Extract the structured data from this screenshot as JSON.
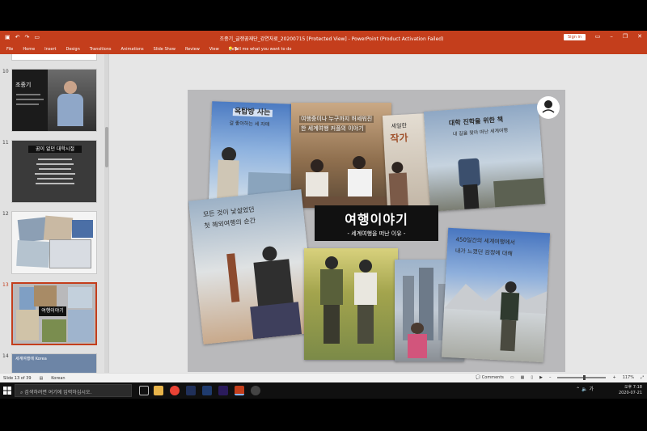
{
  "window": {
    "title": "조종기_글쟁꿈재단_강연자료_20200715 [Protected View] - PowerPoint (Product Activation Failed)",
    "sign_in": "Sign in",
    "accent": "#c43e1c"
  },
  "ribbon": {
    "tabs": [
      "File",
      "Home",
      "Insert",
      "Design",
      "Transitions",
      "Animations",
      "Slide Show",
      "Review",
      "View",
      "Help"
    ],
    "tell_me": "Tell me what you want to do"
  },
  "thumbnails": [
    {
      "num": "10",
      "title": "조종기"
    },
    {
      "num": "11",
      "title": "꿈이 없던 대학시절"
    },
    {
      "num": "12",
      "title": ""
    },
    {
      "num": "13",
      "title": "여행이야기",
      "selected": true
    },
    {
      "num": "14",
      "title": "세계여행에 Korea"
    }
  ],
  "slide": {
    "title": "여행이야기",
    "subtitle": "- 세계여행을 떠난 이유 -",
    "captions": {
      "c1": "옥탑방 사는",
      "c1b": "걸 좋아하는 세 자매",
      "c2": "여행중이나 누구까지 허세워진",
      "c2b": "한 세계여행 커플의 이야기",
      "c3": "세일한",
      "c3b": "작가",
      "c4": "대학 진학을 위한 책",
      "c4b": "내 길을 찾아 떠난 세계여행",
      "c5": "모든 것이 낯설었던",
      "c5b": "첫 해외여행의 순간",
      "c6": "450일간의 세계여행에서",
      "c6b": "내가 느꼈던 감정에 대해"
    }
  },
  "status": {
    "slide_info": "Slide 13 of 39",
    "language": "Korean",
    "comments": "Comments",
    "zoom": "117%"
  },
  "taskbar": {
    "search_placeholder": "검색하려면 여기에 입력하십시오.",
    "time": "오후 7:18",
    "date": "2020-07-21",
    "ime": "가"
  }
}
